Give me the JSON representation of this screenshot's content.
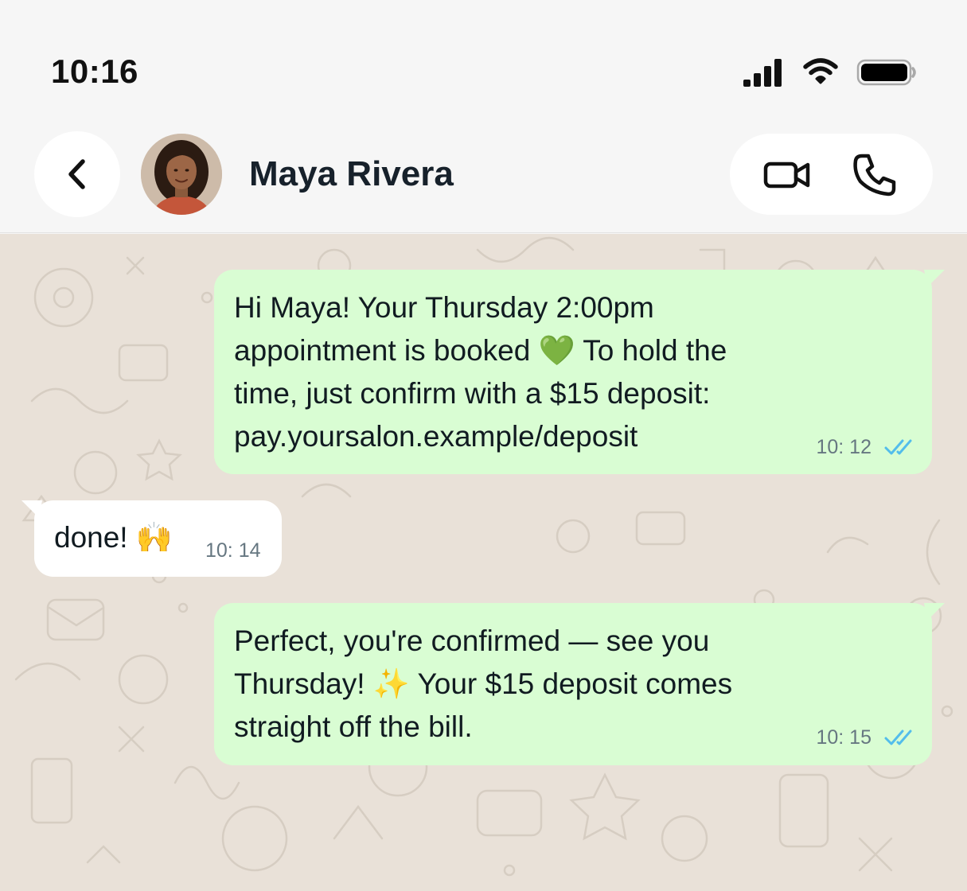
{
  "status_bar": {
    "time": "10:16",
    "icons": [
      "cellular-signal-icon",
      "wifi-icon",
      "battery-icon"
    ]
  },
  "header": {
    "contact_name": "Maya Rivera",
    "buttons": [
      "back-chevron-icon",
      "video-call-icon",
      "phone-icon"
    ]
  },
  "colors": {
    "outgoing_bubble": "#d9fdd3",
    "incoming_bubble": "#ffffff",
    "chat_background": "#e9e1d8",
    "read_ticks": "#53bdeb"
  },
  "messages": [
    {
      "direction": "out",
      "text": "Hi Maya! Your Thursday 2:00pm\nappointment is booked 💚 To hold the\ntime, just confirm with a $15 deposit:\npay.yoursalon.example/deposit",
      "time": "10: 12",
      "status": "read"
    },
    {
      "direction": "in",
      "text": "done! 🙌",
      "time": "10: 14"
    },
    {
      "direction": "out",
      "text": "Perfect, you're confirmed — see you\nThursday! ✨ Your $15 deposit comes\nstraight off the bill.",
      "time": "10: 15",
      "status": "read"
    }
  ]
}
